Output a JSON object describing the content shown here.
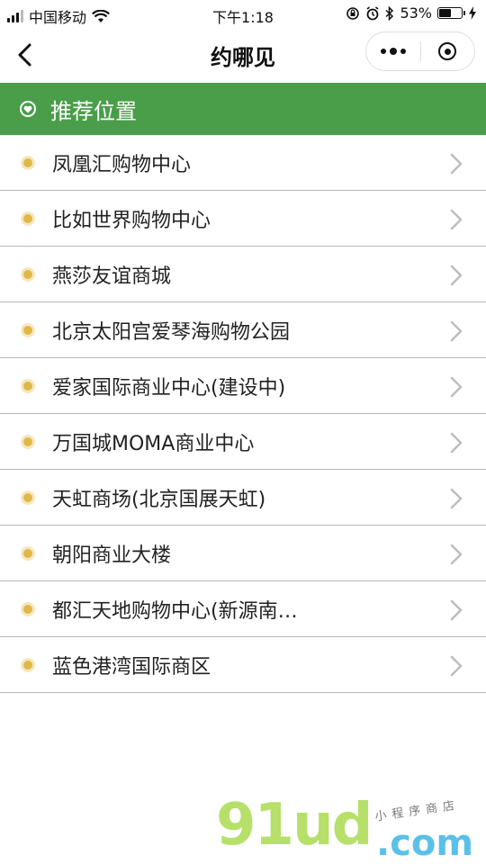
{
  "status_bar": {
    "carrier": "中国移动",
    "time": "下午1:18",
    "battery_percent": "53%",
    "battery_level": 0.53,
    "icons": [
      "signal-icon",
      "wifi-icon",
      "rotation-lock-icon",
      "alarm-icon",
      "bluetooth-icon",
      "battery-icon",
      "charging-icon"
    ]
  },
  "navbar": {
    "title": "约哪见",
    "icons": [
      "back-icon",
      "more-icon",
      "close-miniprogram-icon"
    ]
  },
  "section": {
    "title": "推荐位置",
    "icon": "heart-location-icon",
    "background": "#4a9e4a"
  },
  "places": [
    {
      "label": "凤凰汇购物中心"
    },
    {
      "label": "比如世界购物中心"
    },
    {
      "label": "燕莎友谊商城"
    },
    {
      "label": "北京太阳宫爱琴海购物公园"
    },
    {
      "label": "爱家国际商业中心(建设中)"
    },
    {
      "label": "万国城MOMA商业中心"
    },
    {
      "label": "天虹商场(北京国展天虹)"
    },
    {
      "label": "朝阳商业大楼"
    },
    {
      "label": "都汇天地购物中心(新源南…"
    },
    {
      "label": "蓝色港湾国际商区"
    }
  ],
  "watermark": {
    "logo": "91ud",
    "domain": ".com",
    "tagline": "小程序商店"
  },
  "colors": {
    "accent_green": "#4a9e4a",
    "bullet": "#e0b84a"
  }
}
